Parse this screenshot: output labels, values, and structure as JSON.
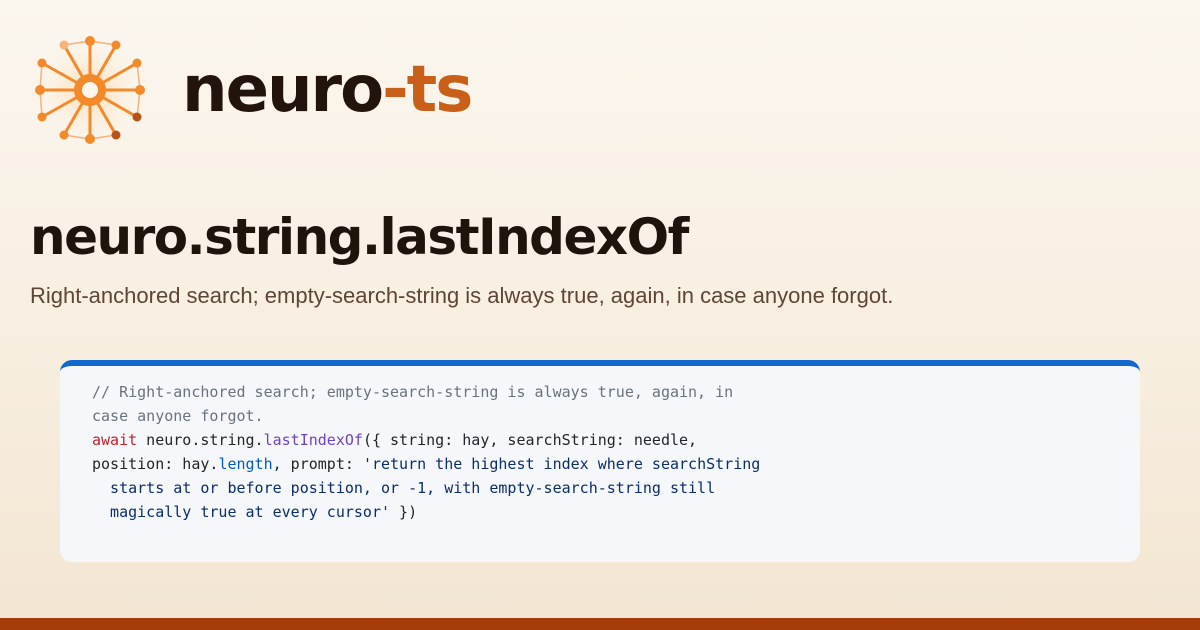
{
  "brand": {
    "name": "neuro",
    "separator": "-",
    "suffix": "ts"
  },
  "page": {
    "title": "neuro.string.lastIndexOf",
    "subtitle": "Right-anchored search; empty-search-string is always true, again, in case anyone forgot."
  },
  "code": {
    "comment_line1": "// Right-anchored search; empty-search-string is always true, again, in",
    "comment_line2": "case anyone forgot.",
    "keyword_await": "await",
    "text_receiver": " neuro.string.",
    "method_name": "lastIndexOf",
    "text_args_open": "({ string: hay, searchString: needle,",
    "text_position": "position: hay.",
    "prop_length": "length",
    "text_prompt_key": ", prompt: ",
    "prompt_string_line1": "'return the highest index where searchString",
    "prompt_string_line2": "  starts at or before position, or -1, with empty-search-string still",
    "prompt_string_line3": "  magically true at every cursor'",
    "text_args_close": " })"
  },
  "colors": {
    "accent_orange": "#c8601a",
    "code_header_blue": "#1368cc",
    "bottom_bar_rust": "#a63c0a",
    "keyword_red": "#c0232c",
    "method_purple": "#6f42c1"
  },
  "icons": {
    "logo": "neuron-burst-icon"
  }
}
